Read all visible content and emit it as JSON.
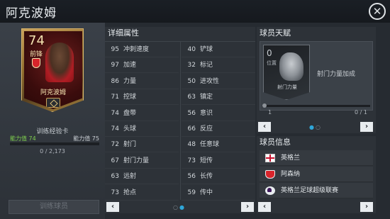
{
  "header": {
    "title": "阿克波姆",
    "close_icon": "close-icon",
    "close_glyph": "✕"
  },
  "player_card": {
    "rating": "74",
    "position": "前锋",
    "name": "阿克波姆",
    "club_crest_icon": "arsenal-crest-icon",
    "rarity_icon": "diamond-badge-icon"
  },
  "training": {
    "card_label": "训练经验卡",
    "ability_label_left": "能力值 74",
    "ability_label_right": "能力值 75",
    "xp_text": "0 / 2,173",
    "xp_progress": 0,
    "train_button": "训练球员"
  },
  "attributes": {
    "header": "详细属性",
    "left": [
      {
        "value": "95",
        "name": "冲刺速度"
      },
      {
        "value": "97",
        "name": "加速"
      },
      {
        "value": "86",
        "name": "力量"
      },
      {
        "value": "71",
        "name": "控球"
      },
      {
        "value": "74",
        "name": "盘带"
      },
      {
        "value": "74",
        "name": "头球"
      },
      {
        "value": "72",
        "name": "射门"
      },
      {
        "value": "67",
        "name": "射门力量"
      },
      {
        "value": "63",
        "name": "远射"
      },
      {
        "value": "73",
        "name": "抢点"
      }
    ],
    "right": [
      {
        "value": "40",
        "name": "铲球"
      },
      {
        "value": "32",
        "name": "标记"
      },
      {
        "value": "50",
        "name": "进攻性"
      },
      {
        "value": "63",
        "name": "镇定"
      },
      {
        "value": "56",
        "name": "意识"
      },
      {
        "value": "66",
        "name": "反应"
      },
      {
        "value": "48",
        "name": "任意球"
      },
      {
        "value": "73",
        "name": "短传"
      },
      {
        "value": "56",
        "name": "长传"
      },
      {
        "value": "59",
        "name": "传中"
      }
    ],
    "prev_glyph": "‹",
    "next_glyph": "›",
    "page_dots": "○●"
  },
  "talent": {
    "header": "球员天赋",
    "card_number": "0",
    "card_position": "位置",
    "card_name": "射门力量",
    "description": "射门力量加成",
    "count_left": "1",
    "count_right": "0 / 1",
    "prev_glyph": "‹",
    "next_glyph": "›",
    "page_dots": "●○"
  },
  "info": {
    "header": "球员信息",
    "items": [
      {
        "icon": "england-flag-icon",
        "text": "英格兰"
      },
      {
        "icon": "arsenal-crest-icon",
        "text": "阿森纳"
      },
      {
        "icon": "premier-league-icon",
        "text": "英格兰足球超级联赛"
      }
    ],
    "prev_glyph": "‹",
    "next_glyph": "›"
  }
}
